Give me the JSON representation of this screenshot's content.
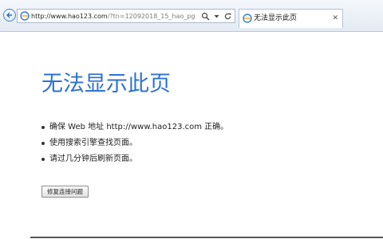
{
  "browser": {
    "address_bar": {
      "url_host": "http://www.hao123.com",
      "url_rest": "/?tn=12092018_15_hao_pg"
    },
    "tab": {
      "title": "无法显示此页",
      "close_glyph": "✕"
    },
    "icons": [
      "back-arrow-icon",
      "page-icon",
      "search-icon",
      "dropdown-arrow-icon",
      "refresh-icon",
      "tab-page-icon",
      "close-icon"
    ],
    "accent_color": "#2e72cf"
  },
  "error_page": {
    "title": "无法显示此页",
    "suggestions": [
      "确保 Web 地址 http://www.hao123.com 正确。",
      "使用搜索引擎查找页面。",
      "请过几分钟后刷新页面。"
    ],
    "fix_button_label": "修复连接问题"
  }
}
